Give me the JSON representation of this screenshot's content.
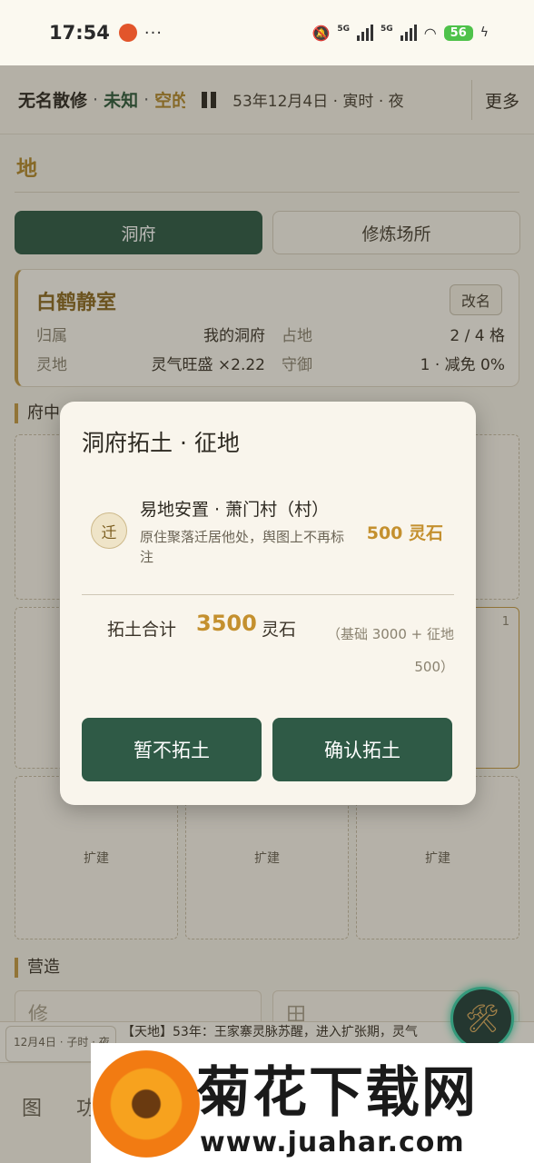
{
  "status_bar": {
    "time": "17:54",
    "battery": "56",
    "network": "5G"
  },
  "app_bar": {
    "name": "无名散修",
    "realm": "未知",
    "location": "空的",
    "separator": "·",
    "date": "53年12月4日 · 寅时 · 夜",
    "more": "更多"
  },
  "page": {
    "section_title": "地"
  },
  "tabs": [
    {
      "label": "洞府",
      "active": true
    },
    {
      "label": "修炼场所",
      "active": false
    }
  ],
  "residence": {
    "name": "白鹤静室",
    "rename_label": "改名",
    "rows": [
      {
        "k1": "归属",
        "v1": "我的洞府",
        "k2": "占地",
        "v2": "2 / 4 格"
      },
      {
        "k1": "灵地",
        "v1": "灵气旺盛 ×2.22",
        "k2": "守御",
        "v2": "1 · 减免 0%"
      }
    ]
  },
  "grid": {
    "section_title": "府中",
    "expand_label": "扩建",
    "corner_number": "1"
  },
  "build": {
    "section_title": "营造",
    "items": [
      "修",
      "田"
    ]
  },
  "log": {
    "time": "12月4日 · 子时 · 夜",
    "text": "【天地】53年：王家寨灵脉苏醒，进入扩张期，灵气"
  },
  "bottom_nav": [
    "图",
    "功"
  ],
  "dialog": {
    "title": "洞府拓土 · 征地",
    "item": {
      "badge": "迁",
      "title": "易地安置 · 萧门村（村）",
      "desc": "原住聚落迁居他处，舆图上不再标注",
      "cost": "500 灵石"
    },
    "total_label": "拓土合计",
    "total_value": "3500",
    "total_unit": "灵石",
    "breakdown": "（基础 3000 + 征地 500）",
    "cancel": "暂不拓土",
    "confirm": "确认拓土"
  },
  "watermark": {
    "title": "菊花下载网",
    "url": "www.juahar.com"
  },
  "colors": {
    "accent_green": "#2f5a46",
    "gold": "#c4902e",
    "background": "#f4f0e6"
  }
}
